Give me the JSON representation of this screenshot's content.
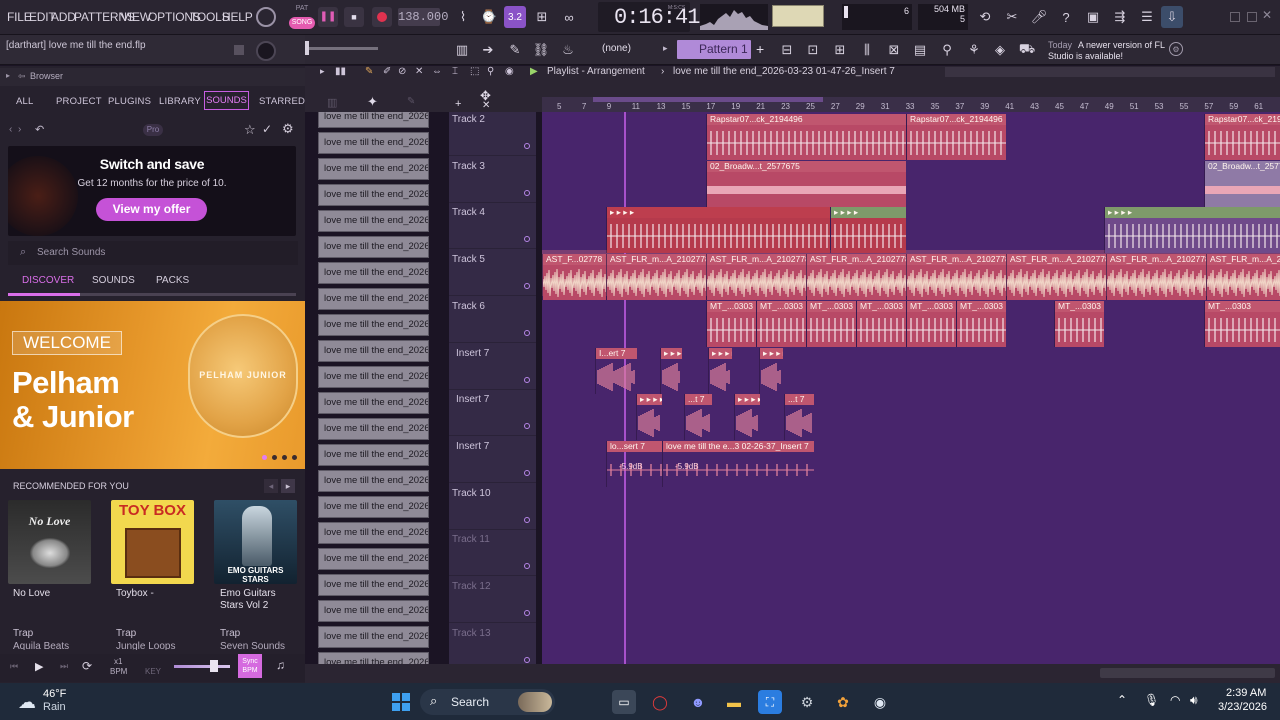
{
  "menu": [
    "FILE",
    "EDIT",
    "ADD",
    "PATTERNS",
    "VIEW",
    "OPTIONS",
    "TOOLS",
    "HELP"
  ],
  "transport": {
    "song_label": "SONG",
    "pat_label": "PAT",
    "tempo": "138.000",
    "step": "3.2",
    "time": "0:16:41",
    "time_unit": "M:S:CS",
    "cpu": "6",
    "ram": "504 MB",
    "polyphony": "5"
  },
  "hint_text": "[darthart] love me till the end.flp",
  "toolbar2": {
    "snap": "(none)",
    "pattern": "Pattern 1"
  },
  "notification": {
    "day": "Today",
    "text": "A newer version of FL Studio is available!"
  },
  "browser": {
    "title": "Browser",
    "tabs": [
      "ALL",
      "PROJECT",
      "PLUGINS",
      "LIBRARY",
      "SOUNDS",
      "STARRED"
    ],
    "active_tab": "SOUNDS",
    "pro_badge": "Pro",
    "promo": {
      "title": "Switch and save",
      "subtitle": "Get 12 months for the price of 10.",
      "button": "View my offer"
    },
    "search_placeholder": "Search Sounds",
    "subtabs": [
      "DISCOVER",
      "SOUNDS",
      "PACKS"
    ],
    "banner": {
      "tag": "WELCOME",
      "title_line1": "Pelham",
      "title_line2": "& Junior",
      "badge_text": "PELHAM JUNIOR"
    },
    "recommended_label": "RECOMMENDED FOR YOU",
    "cards": [
      {
        "title": "No Love",
        "genre": "Trap",
        "author": "Aquila Beats",
        "art_text": "No Love"
      },
      {
        "title": "Toybox -",
        "genre": "Trap",
        "author": "Jungle Loops",
        "art_text": "TOY BOX"
      },
      {
        "title": "Emo Guitars Stars Vol 2",
        "genre": "Trap",
        "author": "Seven Sounds",
        "art_text": "EMO GUITARS STARS"
      }
    ],
    "bottom": {
      "bpm_mult": "x1",
      "bpm": "BPM",
      "key": "KEY",
      "sync_line1": "Sync",
      "sync_line2": "BPM"
    }
  },
  "playlist": {
    "title": "Playlist - Arrangement",
    "project": "love me till the end_2026-03-23 01-47-26_Insert 7",
    "ruler": [
      "5",
      "7",
      "9",
      "11",
      "13",
      "15",
      "17",
      "19",
      "21",
      "23",
      "25",
      "27",
      "29",
      "31",
      "33",
      "35",
      "37",
      "39",
      "41",
      "43",
      "45",
      "47",
      "49",
      "51",
      "53",
      "55",
      "57",
      "59",
      "61"
    ],
    "pattern_name": "love me till the end_2026...",
    "tracks": [
      "Track 2",
      "Track 3",
      "Track 4",
      "Track 5",
      "Track 6",
      "Insert 7",
      "Insert 7",
      "Insert 7",
      "Track 10",
      "Track 11",
      "Track 12",
      "Track 13"
    ],
    "clips": {
      "rapstar": "Rapstar07...ck_2194496",
      "broadway": "02_Broadw...t_2577675",
      "ast_left": "AST_F...02778",
      "ast": "AST_FLR_m...A_2102778",
      "mt": "MT_...0303",
      "insert_a": "I...ert 7",
      "insert_b": "...t 7",
      "insert_c": "lo...sert 7",
      "insert_d": "love me till the e...3 02-26-37_Insert 7",
      "db": "-5.9dB"
    }
  },
  "taskbar": {
    "weather_temp": "46°F",
    "weather_desc": "Rain",
    "search": "Search",
    "time": "2:39 AM",
    "date": "3/23/2026"
  }
}
